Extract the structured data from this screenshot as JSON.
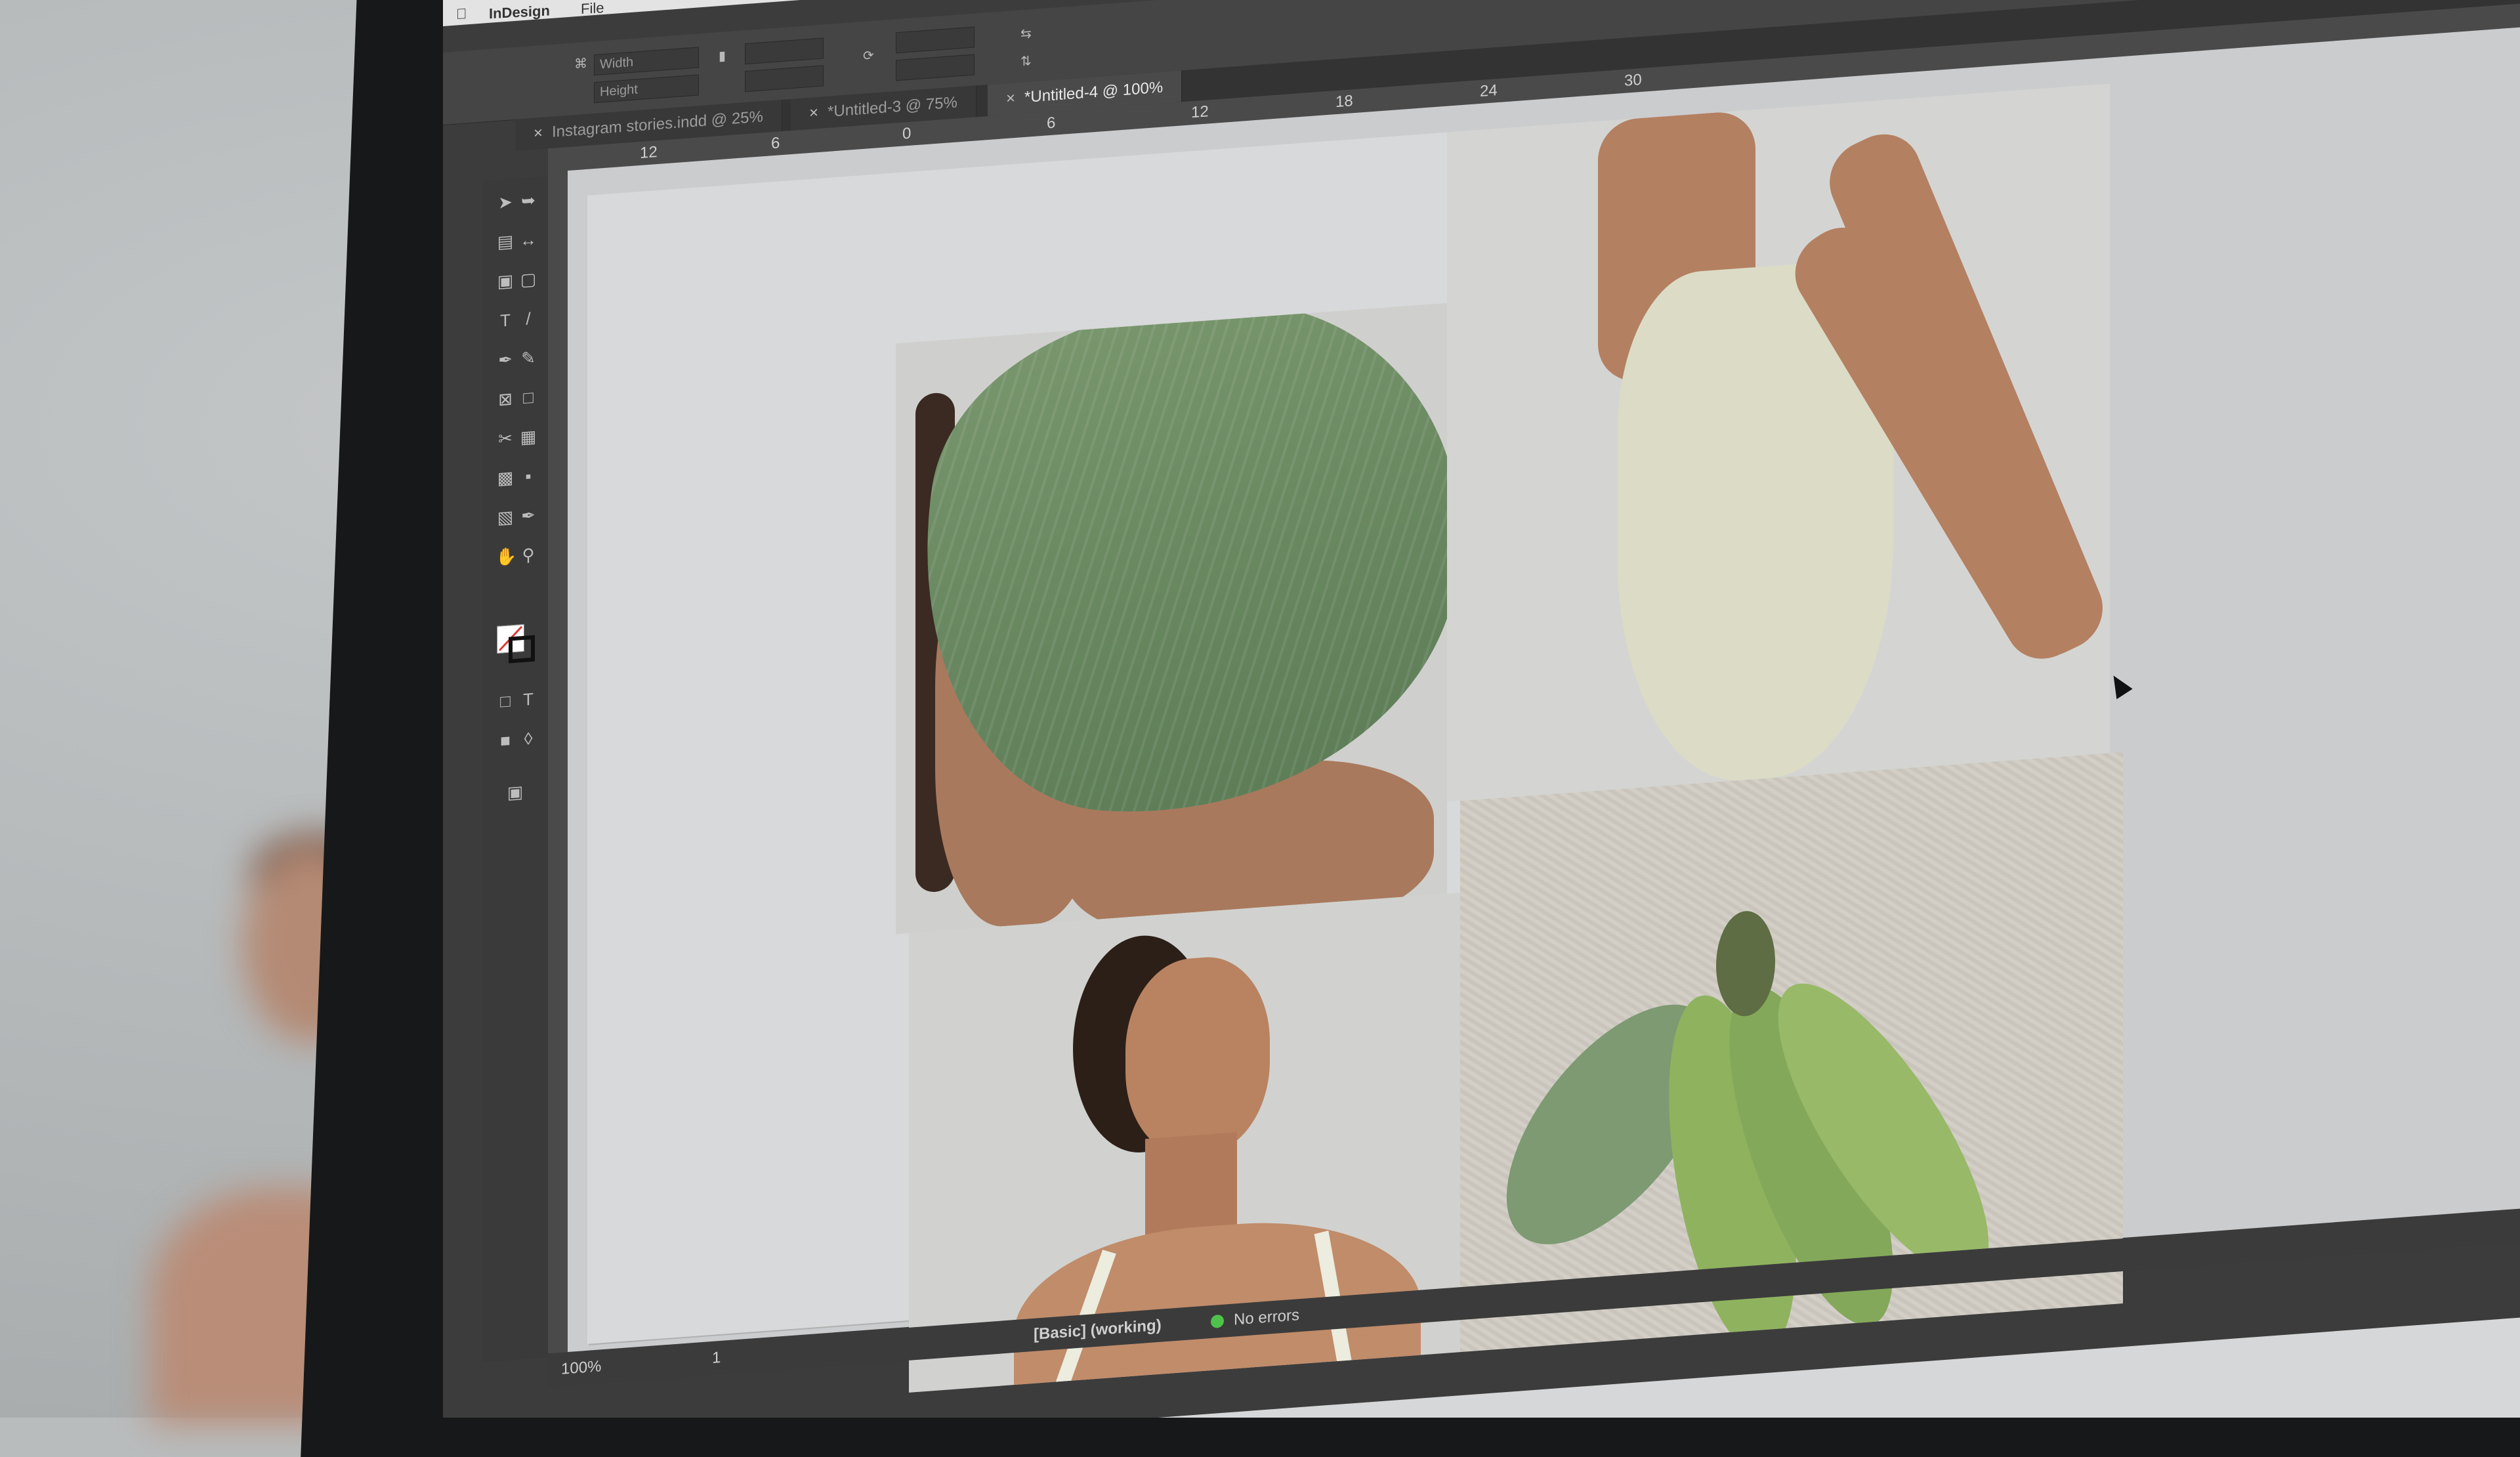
{
  "app": {
    "name": "InDesign",
    "menu": [
      "File"
    ]
  },
  "document_tabs": [
    {
      "label": "Instagram stories.indd @ 25%",
      "active": false
    },
    {
      "label": "*Untitled-3 @ 75%",
      "active": false
    },
    {
      "label": "*Untitled-4 @ 100%",
      "active": true
    }
  ],
  "control_panel": {
    "fields": [
      "Width",
      "Height"
    ]
  },
  "ruler_top": {
    "marks": [
      "12",
      "6",
      "0",
      "6",
      "12",
      "18",
      "24",
      "30"
    ]
  },
  "icons": {
    "apple": "apple-logo-icon",
    "home": "home-icon",
    "selection": "selection-arrow-icon",
    "direct_selection": "direct-selection-icon",
    "type": "type-tool-icon",
    "pen": "pen-tool-icon",
    "rectangle_frame": "rectangle-frame-icon",
    "scissors": "scissors-icon",
    "hand": "hand-tool-icon",
    "zoom": "zoom-tool-icon",
    "cursor": "mouse-pointer-icon"
  },
  "status_bar": {
    "zoom": "100%",
    "page": "1",
    "preflight_profile": "[Basic] (working)",
    "preflight_status": "No errors",
    "status_color": "#4fc24a"
  },
  "colors": {
    "app_dark": "#3c3c3c",
    "pasteboard": "#cbccce"
  }
}
